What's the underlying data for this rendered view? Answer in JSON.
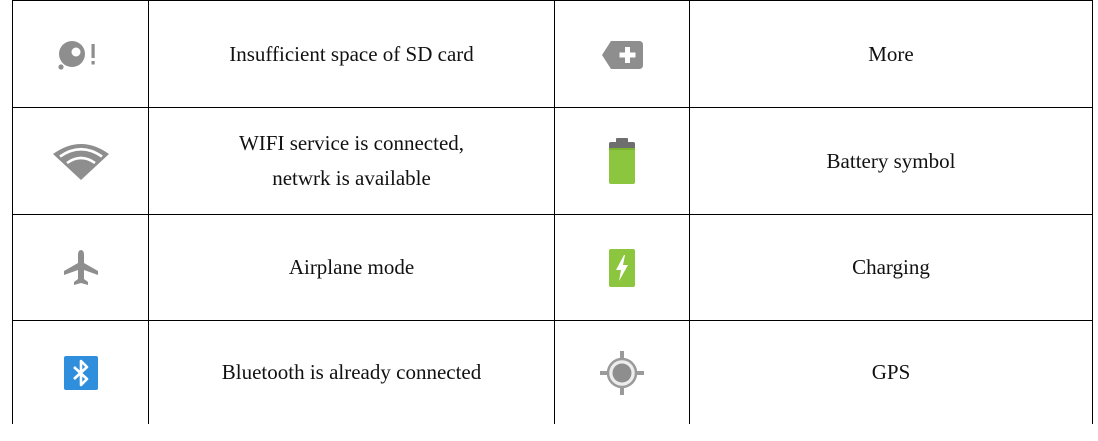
{
  "rows": [
    {
      "left": {
        "icon": "sd-card-warning-icon",
        "text": "Insufficient space of SD card"
      },
      "right": {
        "icon": "more-plus-icon",
        "text": "More"
      }
    },
    {
      "left": {
        "icon": "wifi-icon",
        "line1": "WIFI service is connected,",
        "line2": "netwrk is available"
      },
      "right": {
        "icon": "battery-icon",
        "text": "Battery symbol"
      }
    },
    {
      "left": {
        "icon": "airplane-icon",
        "text": "Airplane mode"
      },
      "right": {
        "icon": "charging-icon",
        "text": "Charging"
      }
    },
    {
      "left": {
        "icon": "bluetooth-icon",
        "text": "Bluetooth is already connected"
      },
      "right": {
        "icon": "gps-icon",
        "text": "GPS"
      }
    }
  ],
  "colors": {
    "icon_gray": "#8e8e8e",
    "battery_green": "#8cc63e",
    "bluetooth_blue": "#2f8fdd",
    "border": "#000000"
  }
}
